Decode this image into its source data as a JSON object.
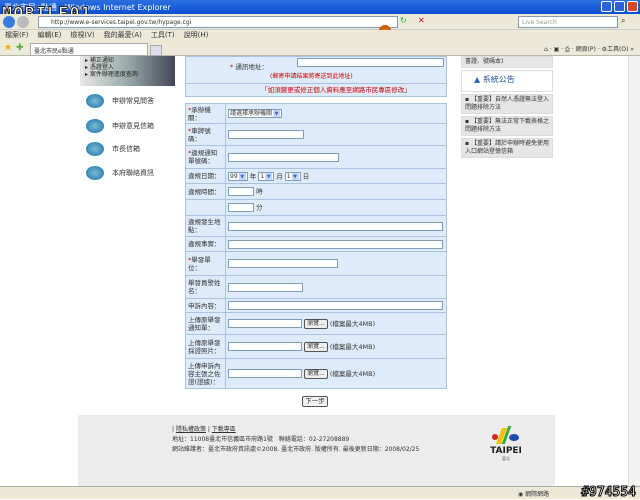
{
  "window": {
    "title": "臺北市民e點通 - Windows Internet Explorer",
    "watermark": "MOBILE01",
    "address": "http://www.e-services.taipei.gov.tw/hypage.cgi",
    "search_placeholder": "Live Search"
  },
  "menu": [
    "檔案(F)",
    "編輯(E)",
    "檢視(V)",
    "我的最愛(A)",
    "工具(T)",
    "說明(H)"
  ],
  "tab": {
    "label": "臺北市民e點通"
  },
  "toolbar_right": {
    "page": "網頁(P)",
    "tools": "工具(O)"
  },
  "sidebar": {
    "top_links": [
      "補正通知",
      "憑證登入",
      "案件辦理進度查詢"
    ],
    "items": [
      "申辦常見問答",
      "申辦意見信箱",
      "市長信箱",
      "本府聯絡資訊"
    ]
  },
  "form": {
    "address_label": "通訊地址：",
    "address_note": "(郵寄申請結果將寄送到此地址)",
    "profile_note": "「如須變更或修正個人資料應至網路市民專區修改」",
    "agency_label": "承辦機關：",
    "agency_value": "請選擇承辦機關",
    "plate_label": "車牌號碼：",
    "ticket_label": "違規通知單號碼：",
    "date_label": "違規日期：",
    "year_value": "99",
    "year_unit": "年",
    "month_value": "1",
    "month_unit": "月",
    "day_value": "1",
    "day_unit": "日",
    "time_label": "違規時間：",
    "hour_unit": "時",
    "minute_unit": "分",
    "place_label": "違規發生地點：",
    "fact_label": "違規事實：",
    "unit_label": "舉發單位：",
    "officer_label": "舉發員警姓名：",
    "content_label": "申訴內容：",
    "uploads": [
      {
        "label": "上傳原舉發通知單："
      },
      {
        "label": "上傳原舉發採證照片："
      },
      {
        "label": "上傳申訴內容主張之佐證(證據)："
      }
    ],
    "browse_label": "瀏覽...",
    "size_note": "(檔案最大4MB)",
    "next_label": "下一步"
  },
  "right": {
    "top_text": "書證、號碼本)",
    "announce_title": "系統公告",
    "announcements": [
      "【重要】自然人憑證無法登入問題排除方法",
      "【重要】無法正常下載表格之問題排除方法",
      "【重要】請於申辦時避免使用入口網站登憶信箱"
    ]
  },
  "footer": {
    "links": [
      "隱私權政策",
      "下載專區"
    ],
    "address": "地址：11008臺北市信義區市府路1號　聯絡電話：02-27208889",
    "copyright": "網站維護者：臺北市政府資訊處©2008. 臺北市政府. 版權所有. 最後更新日期：2008/02/25",
    "logo": "TAIPEI",
    "logo_sub": "臺北"
  },
  "status": {
    "zone": "網際網路",
    "id": "#974554"
  }
}
